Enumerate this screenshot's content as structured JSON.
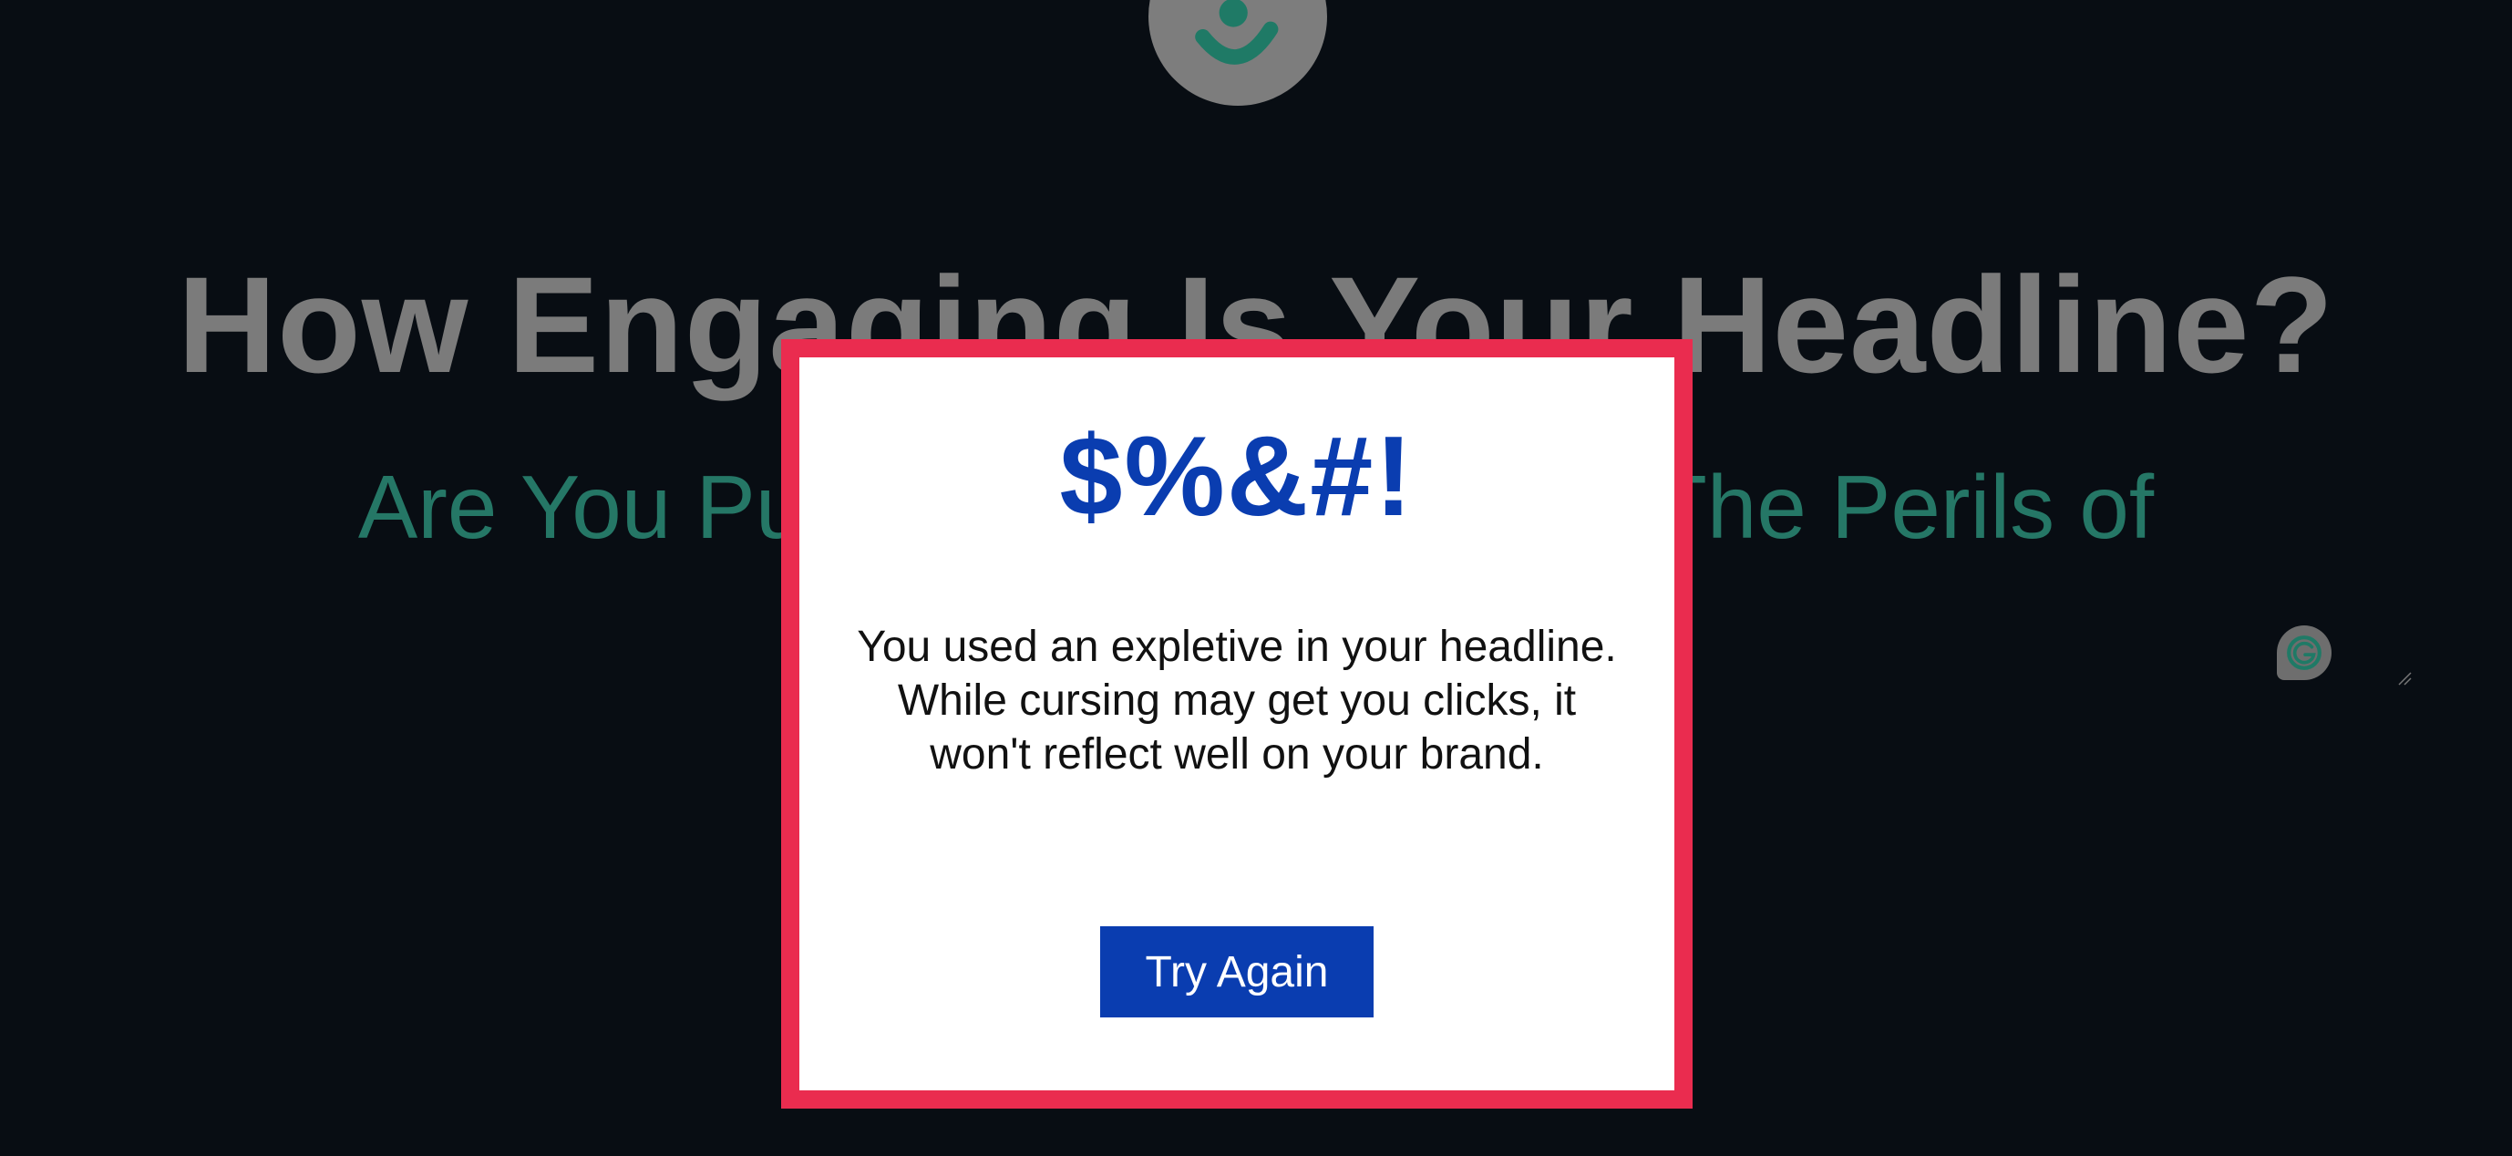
{
  "background": {
    "headline_heading": "How Engaging Is Your Headline?",
    "headline_input_value": "Are You Pumping Out Clickbait? The Perils of"
  },
  "modal": {
    "title": "$%&#!",
    "message": "You used an expletive in your headline. While cursing may get you clicks, it won't reflect well on your brand.",
    "button_label": "Try Again"
  },
  "colors": {
    "background": "#080d13",
    "modal_border": "#ea2c4f",
    "accent_blue": "#0a3db0",
    "teal": "#257766"
  }
}
